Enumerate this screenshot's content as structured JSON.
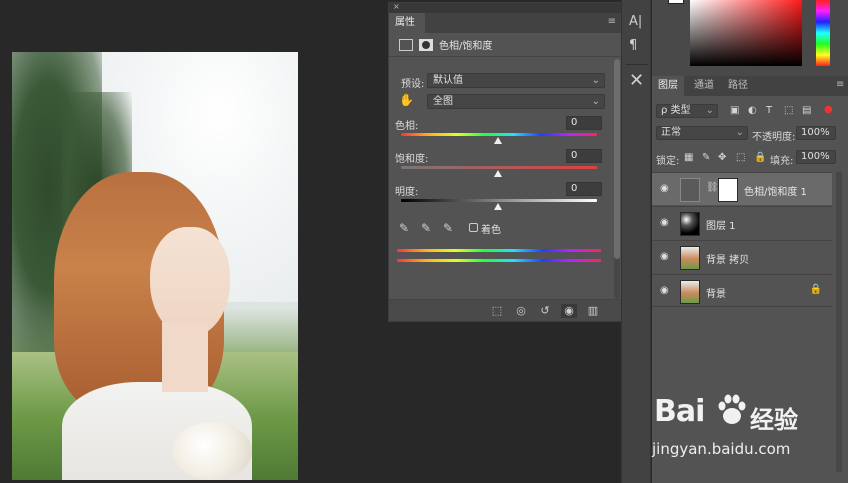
{
  "properties_panel": {
    "tab_label": "属性",
    "title": "色相/饱和度",
    "preset_label": "预设:",
    "preset_value": "默认值",
    "channel_value": "全图",
    "hue_label": "色相:",
    "hue_value": "0",
    "saturation_label": "饱和度:",
    "saturation_value": "0",
    "lightness_label": "明度:",
    "lightness_value": "0",
    "colorize_label": "着色"
  },
  "layers_panel": {
    "tabs": [
      "图层",
      "通道",
      "路径"
    ],
    "filter_kind": "ρ 类型",
    "blend_mode": "正常",
    "opacity_label": "不透明度:",
    "opacity_value": "100%",
    "lock_label": "锁定:",
    "fill_label": "填充:",
    "fill_value": "100%",
    "layers": [
      {
        "name": "色相/饱和度 1",
        "selected": true
      },
      {
        "name": "图层 1",
        "selected": false
      },
      {
        "name": "背景 拷贝",
        "selected": false
      },
      {
        "name": "背景",
        "selected": false,
        "locked": true
      }
    ]
  },
  "watermark": {
    "brand": "Bai",
    "brand_cn": "经验",
    "url": "jingyan.baidu.com"
  },
  "colors": {
    "panel_bg": "#535353",
    "canvas_bg": "#282828",
    "selected_layer": "#6a6a6a"
  }
}
